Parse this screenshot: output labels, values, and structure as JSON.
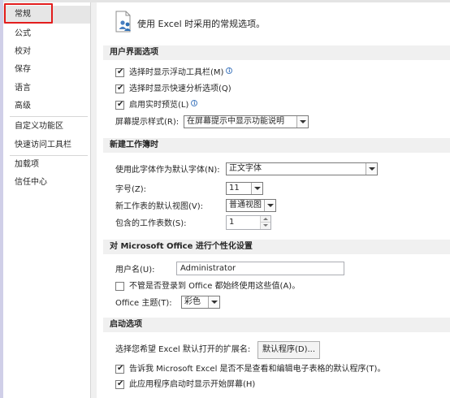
{
  "sidebar": {
    "items": [
      {
        "label": "常规"
      },
      {
        "label": "公式"
      },
      {
        "label": "校对"
      },
      {
        "label": "保存"
      },
      {
        "label": "语言"
      },
      {
        "label": "高级"
      },
      {
        "label": "自定义功能区"
      },
      {
        "label": "快速访问工具栏"
      },
      {
        "label": "加载项"
      },
      {
        "label": "信任中心"
      }
    ]
  },
  "header": {
    "title": "使用 Excel 时采用的常规选项。",
    "icon": "options-people-icon"
  },
  "ui_options": {
    "section_title": "用户界面选项",
    "mini_toolbar": {
      "label": "选择时显示浮动工具栏(M)",
      "checked": true
    },
    "quick_analysis": {
      "label": "选择时显示快速分析选项(Q)",
      "checked": true
    },
    "live_preview": {
      "label": "启用实时预览(L)",
      "checked": true
    },
    "screentip": {
      "label": "屏幕提示样式(R):",
      "value": "在屏幕提示中显示功能说明"
    }
  },
  "new_workbook": {
    "section_title": "新建工作簿时",
    "font": {
      "label": "使用此字体作为默认字体(N):",
      "value": "正文字体"
    },
    "font_size": {
      "label": "字号(Z):",
      "value": "11"
    },
    "default_view": {
      "label": "新工作表的默认视图(V):",
      "value": "普通视图"
    },
    "sheet_count": {
      "label": "包含的工作表数(S):",
      "value": "1"
    }
  },
  "personalize": {
    "section_title": "对 Microsoft Office 进行个性化设置",
    "username": {
      "label": "用户名(U):",
      "value": "Administrator"
    },
    "always_use": {
      "label": "不管是否登录到 Office 都始终使用这些值(A)。",
      "checked": false
    },
    "theme": {
      "label": "Office 主题(T):",
      "value": "彩色"
    }
  },
  "startup": {
    "section_title": "启动选项",
    "extensions": {
      "label": "选择您希望 Excel 默认打开的扩展名:",
      "button": "默认程序(D)..."
    },
    "tell_default": {
      "label": "告诉我 Microsoft Excel 是否不是查看和编辑电子表格的默认程序(T)。",
      "checked": true
    },
    "show_start": {
      "label": "此应用程序启动时显示开始屏幕(H)",
      "checked": true
    }
  }
}
